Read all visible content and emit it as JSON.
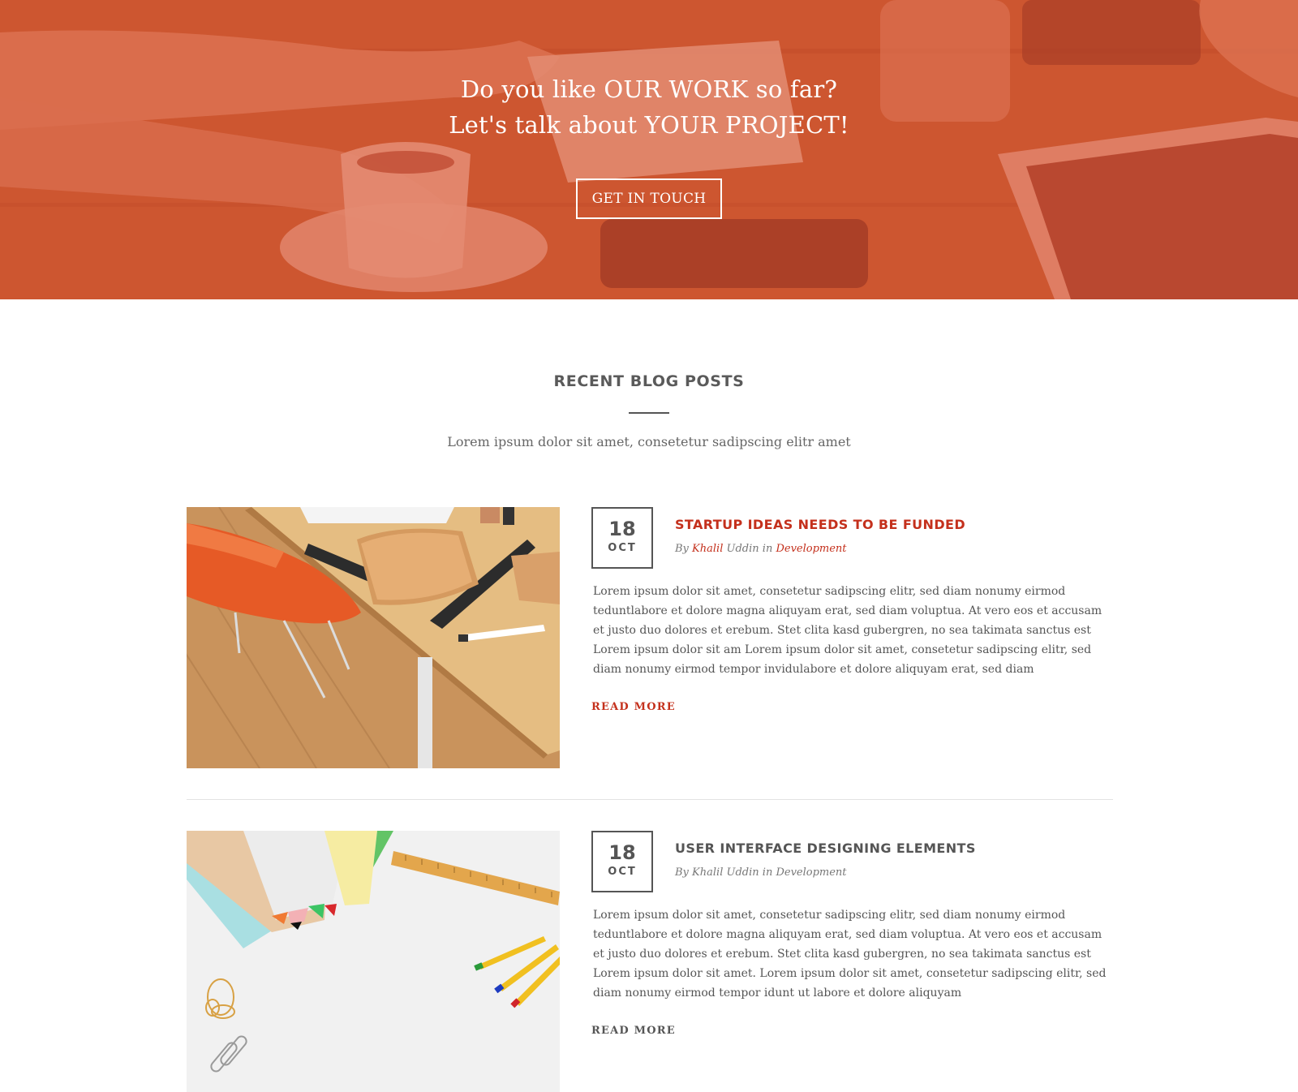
{
  "hero": {
    "line1": "Do you like OUR WORK so far?",
    "line2": "Let's talk about YOUR PROJECT!",
    "cta_label": "GET IN TOUCH"
  },
  "blog": {
    "title": "RECENT BLOG POSTS",
    "subtitle": "Lorem ipsum dolor sit amet, consetetur sadipscing elitr amet",
    "posts": [
      {
        "day": "18",
        "month": "OCT",
        "title": "STARTUP IDEAS NEEDS TO BE FUNDED",
        "by": "By",
        "author_first": "Khalil",
        "author_last": "Uddin",
        "in": "in",
        "category": "Development",
        "body": "Lorem ipsum dolor sit amet, consetetur sadipscing elitr, sed diam nonumy eirmod teduntlabore et dolore magna aliquyam erat, sed diam voluptua. At vero eos et accusam et justo duo dolores et erebum. Stet clita kasd gubergren, no sea takimata sanctus est Lorem ipsum dolor sit am Lorem ipsum dolor sit amet, consetetur sadipscing elitr, sed diam nonumy eirmod tempor invidulabore et dolore aliquyam erat, sed diam",
        "read_more": "READ MORE"
      },
      {
        "day": "18",
        "month": "OCT",
        "title": "USER INTERFACE DESIGNING ELEMENTS",
        "by": "By",
        "author_first": "Khalil",
        "author_last": "Uddin",
        "in": "in",
        "category": "Development",
        "body": "Lorem ipsum dolor sit amet, consetetur sadipscing elitr, sed diam nonumy eirmod teduntlabore et dolore magna aliquyam erat, sed diam voluptua. At vero eos et accusam et justo duo dolores et erebum. Stet clita kasd gubergren, no sea takimata sanctus est Lorem ipsum dolor sit amet. Lorem ipsum dolor sit amet, consetetur sadipscing elitr, sed diam nonumy eirmod tempor idunt ut labore et dolore aliquyam",
        "read_more": "READ MORE"
      }
    ]
  },
  "colors": {
    "accent": "#c4301c",
    "hero_tint": "#d64c2c",
    "text": "#555555"
  }
}
